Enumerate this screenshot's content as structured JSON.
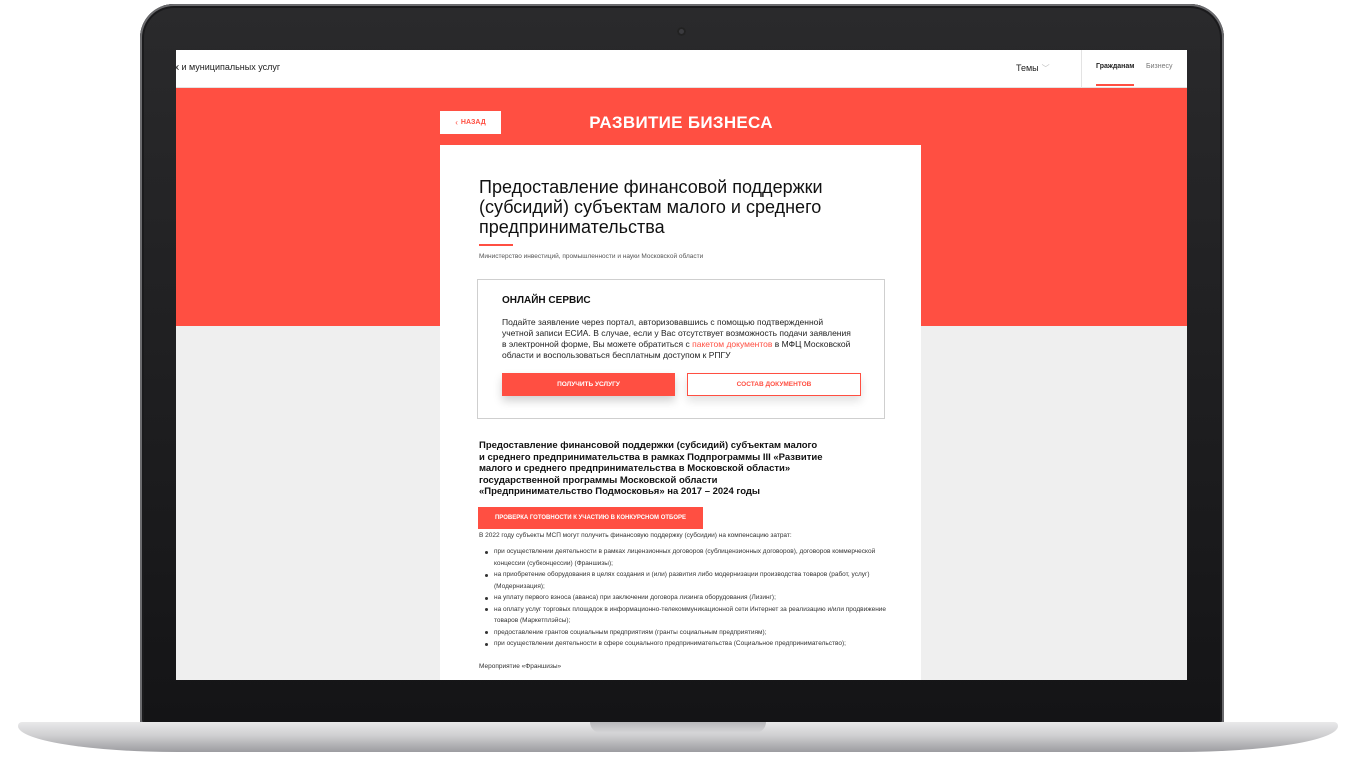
{
  "header": {
    "portal_name": "ых и муниципальных услуг",
    "topics_label": "Темы",
    "tabs": [
      {
        "label": "Гражданам",
        "active": true
      },
      {
        "label": "Бизнесу",
        "active": false
      }
    ]
  },
  "banner": {
    "back_label": "НАЗАД",
    "section_title": "РАЗВИТИЕ БИЗНЕСА"
  },
  "service": {
    "title": "Предоставление финансовой поддержки (субсидий) субъектам малого и среднего предпринимательства",
    "ministry": "Министерство инвестиций, промышленности и науки Московской области",
    "online": {
      "heading": "ОНЛАЙН СЕРВИС",
      "text_before": "Подайте заявление через портал, авторизовавшись с помощью подтвержденной учетной записи ЕСИА. В случае, если у Вас отсутствует возможность подачи заявления в электронной форме, Вы можете обратиться с ",
      "link_text": "пакетом документов",
      "text_after": " в МФЦ Московской области и воспользоваться бесплатным доступом к РПГУ",
      "get_button": "ПОЛУЧИТЬ УСЛУГУ",
      "docs_button": "СОСТАВ ДОКУМЕНТОВ"
    },
    "program_title": "Предоставление финансовой поддержки (субсидий) субъектам малого и среднего предпринимательства в рамках Подпрограммы III «Развитие малого и среднего предпринимательства в Московской области» государственной программы Московской области «Предпринимательство Подмосковья» на 2017 – 2024 годы",
    "check_button": "ПРОВЕРКА ГОТОВНОСТИ К УЧАСТИЮ В КОНКУРСНОМ ОТБОРЕ",
    "intro": "В 2022 году субъекты МСП могут получить финансовую поддержку (субсидии) на компенсацию затрат:",
    "bullets": [
      "при осуществлении деятельности в рамках лицензионных договоров (сублицензионных договоров), договоров коммерческой концессии (субконцессии) (Франшизы);",
      "на приобретение оборудования в целях создания и (или) развития либо модернизации производства товаров (работ, услуг) (Модернизация);",
      "на уплату первого взноса (аванса) при заключении договора лизинга оборудования (Лизинг);",
      "на оплату услуг торговых площадок в информационно-телекоммуникационной сети Интернет за реализацию и/или продвижение товаров (Маркетплэйсы);",
      "предоставление грантов социальным предприятиям (гранты социальным предприятиям);",
      "при осуществлении деятельности в сфере социального предпринимательства (Социальное предпринимательство);"
    ],
    "event_label": "Мероприятие «Франшизы»"
  },
  "colors": {
    "accent": "#ff4f42",
    "page_bg": "#efefef",
    "card_bg": "#ffffff"
  }
}
